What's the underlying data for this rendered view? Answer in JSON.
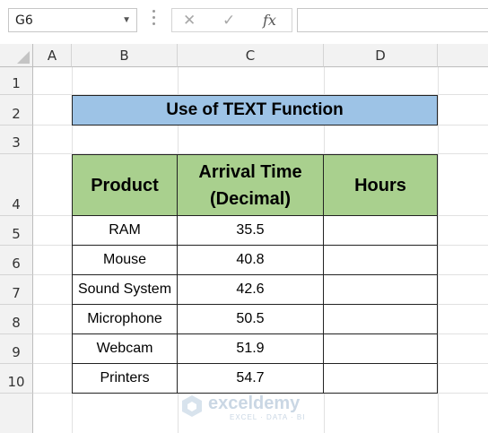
{
  "formula_bar": {
    "name_box": "G6",
    "cancel_icon": "✕",
    "enter_icon": "✓",
    "function_label": "fx",
    "formula": ""
  },
  "columns": [
    "A",
    "B",
    "C",
    "D"
  ],
  "rows": [
    "1",
    "2",
    "3",
    "4",
    "5",
    "6",
    "7",
    "8",
    "9",
    "10"
  ],
  "title": "Use of TEXT Function",
  "table": {
    "headers": [
      "Product",
      "Arrival Time (Decimal)",
      "Hours"
    ],
    "header_line1": "Arrival Time",
    "header_line2": "(Decimal)",
    "rows": [
      {
        "product": "RAM",
        "arrival": "35.5",
        "hours": ""
      },
      {
        "product": "Mouse",
        "arrival": "40.8",
        "hours": ""
      },
      {
        "product": "Sound System",
        "arrival": "42.6",
        "hours": ""
      },
      {
        "product": "Microphone",
        "arrival": "50.5",
        "hours": ""
      },
      {
        "product": "Webcam",
        "arrival": "51.9",
        "hours": ""
      },
      {
        "product": "Printers",
        "arrival": "54.7",
        "hours": ""
      }
    ]
  },
  "watermark": {
    "name": "exceldemy",
    "tagline": "EXCEL · DATA · BI"
  },
  "colors": {
    "title_fill": "#9dc3e6",
    "header_fill": "#a9d08e"
  }
}
